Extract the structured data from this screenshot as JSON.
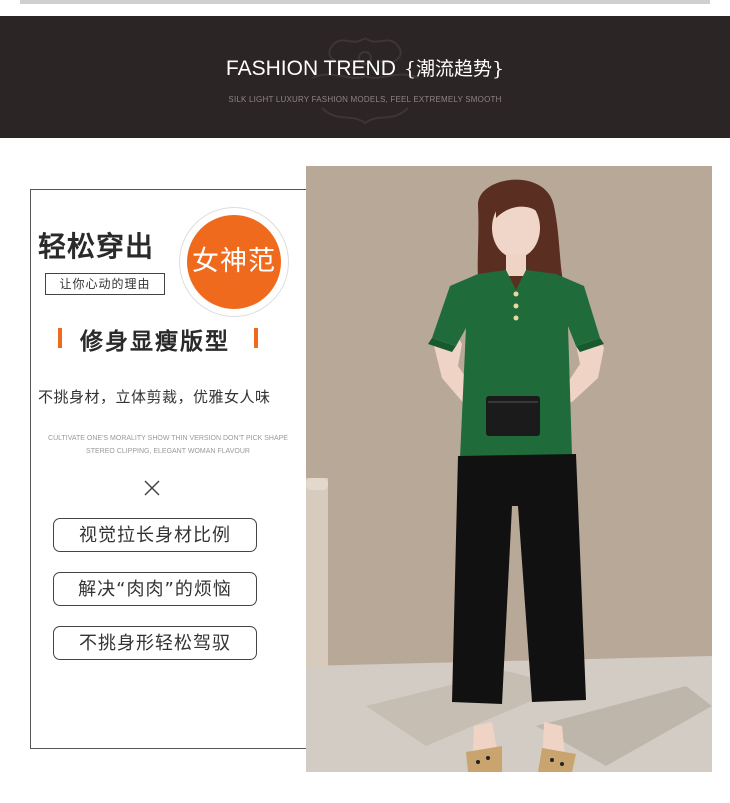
{
  "banner": {
    "title": "FASHION TREND",
    "title_cn": "{潮流趋势}",
    "subtitle": "SILK LIGHT LUXURY FASHION MODELS, FEEL EXTREMELY SMOOTH"
  },
  "card": {
    "headline": "轻松穿出",
    "badge": "女神范",
    "subtag": "让你心动的理由",
    "feature_title": "修身显瘦版型",
    "description": "不挑身材，立体剪裁，优雅女人味",
    "english_lines": [
      "CULTIVATE ONE'S MORALITY SHOW THIN VERSION DON'T PICK SHAPE",
      "STEREO CLIPPING, ELEGANT WOMAN FLAVOUR"
    ],
    "benefits": [
      "视觉拉长身材比例",
      "解决“肉肉”的烦恼",
      "不挑身形轻松驾驭"
    ]
  },
  "colors": {
    "banner_bg": "#2b2526",
    "accent_orange": "#f06a1d",
    "top_green": "#1f6b3a",
    "pants_black": "#111111",
    "backdrop": "#b3a394"
  }
}
